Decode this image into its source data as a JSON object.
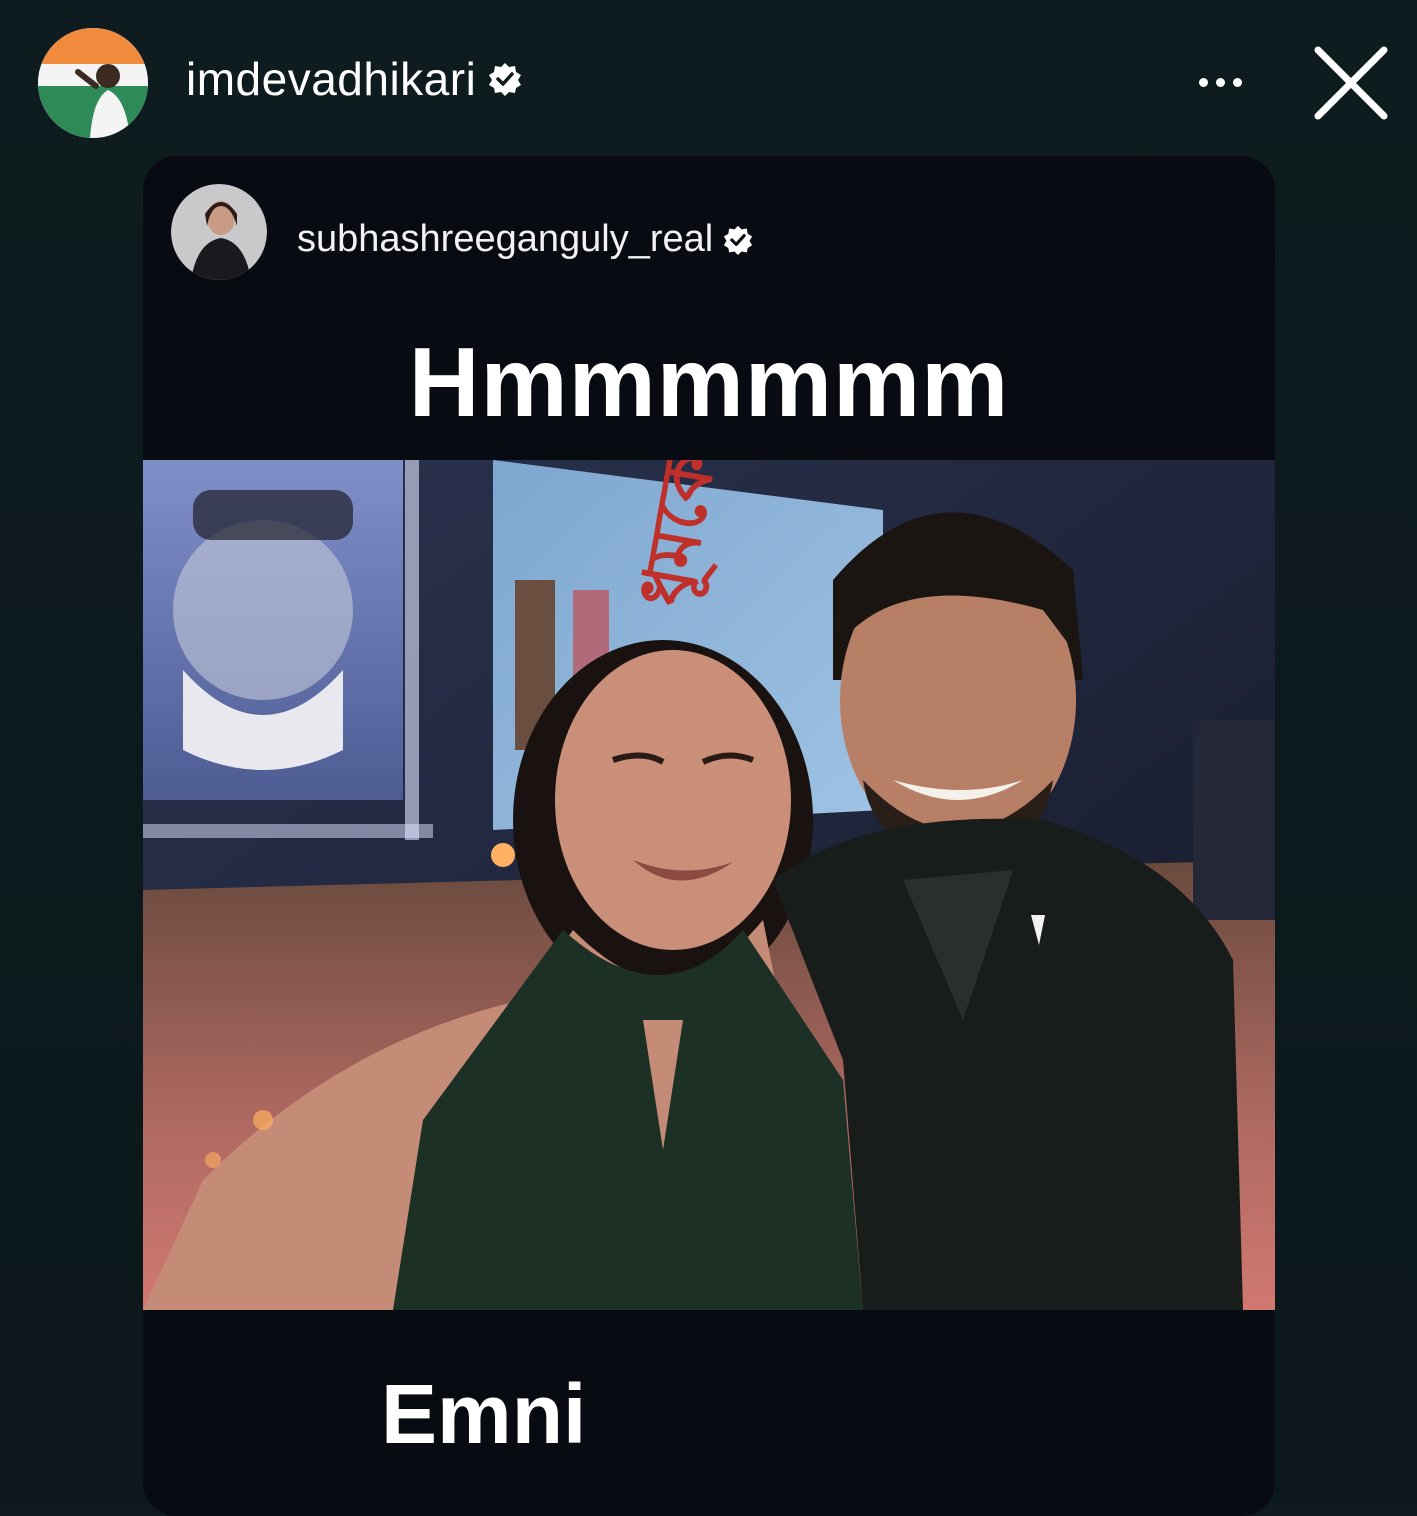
{
  "story": {
    "username": "imdevadhikari",
    "verified_icon": "verified-badge-icon",
    "more_icon": "more-options-icon",
    "close_icon": "close-icon"
  },
  "shared_post": {
    "username": "subhashreeganguly_real",
    "caption_top": "Hmmmmmm",
    "caption_bottom": "Emni",
    "poster_title_bengali": "ধূমকেতু",
    "photo_description_icon": "selfie-photo"
  },
  "colors": {
    "background": "#0e1a1d",
    "card": "#080b12",
    "text": "#ffffff"
  }
}
